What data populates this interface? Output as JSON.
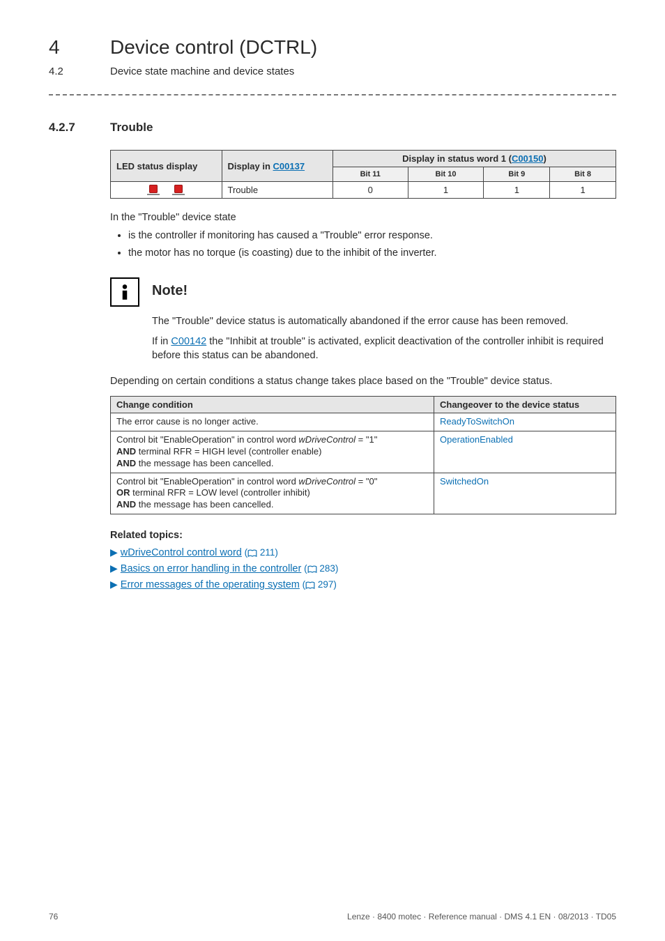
{
  "header": {
    "chapter_num": "4",
    "chapter_title": "Device control (DCTRL)",
    "sub_num": "4.2",
    "sub_title": "Device state machine and device states"
  },
  "section": {
    "num": "4.2.7",
    "title": "Trouble"
  },
  "table1": {
    "col_led": "LED status display",
    "col_display_in": "Display in ",
    "col_display_code": "C00137",
    "col_statusword": "Display in status word 1 (",
    "col_statusword_code": "C00150",
    "col_statusword_close": ")",
    "bit11": "Bit 11",
    "bit10": "Bit 10",
    "bit9": "Bit 9",
    "bit8": "Bit 8",
    "row_name": "Trouble",
    "v_b11": "0",
    "v_b10": "1",
    "v_b9": "1",
    "v_b8": "1"
  },
  "prose": {
    "intro": "In the \"Trouble\" device state",
    "li1": "is the controller if monitoring has caused a \"Trouble\" error response.",
    "li2": "the motor has no torque (is coasting) due to the inhibit of the inverter."
  },
  "note": {
    "title": "Note!",
    "p1": "The \"Trouble\" device status is automatically abandoned if the error cause has been removed.",
    "p2a": "If in ",
    "p2_code": "C00142",
    "p2b": " the \"Inhibit at trouble\" is activated, explicit deactivation of the controller inhibit is required before this status can be abandoned."
  },
  "between_para": "Depending on certain conditions a status change takes place based on the \"Trouble\" device status.",
  "table2": {
    "h1": "Change condition",
    "h2": "Changeover to the device status",
    "r1c1": "The error cause is no longer active.",
    "r1c2": "ReadyToSwitchOn",
    "r2c1_a": "Control bit \"EnableOperation\" in control word ",
    "r2c1_it": "wDriveControl",
    "r2c1_b": " = \"1\"",
    "r2c1_and1": "AND",
    "r2c1_line2": " terminal RFR = HIGH level (controller enable)",
    "r2c1_and2": "AND",
    "r2c1_line3": " the message has been cancelled.",
    "r2c2": "OperationEnabled",
    "r3c1_a": "Control bit \"EnableOperation\" in control word ",
    "r3c1_it": "wDriveControl",
    "r3c1_b": " = \"0\"",
    "r3c1_or": "OR",
    "r3c1_line2": " terminal RFR = LOW level (controller inhibit)",
    "r3c1_and": "AND",
    "r3c1_line3": " the message has been cancelled.",
    "r3c2": "SwitchedOn"
  },
  "related": {
    "title": "Related topics:",
    "items": [
      {
        "text": "wDriveControl control word",
        "page": "211"
      },
      {
        "text": "Basics on error handling in the controller",
        "page": "283"
      },
      {
        "text": "Error messages of the operating system",
        "page": "297"
      }
    ]
  },
  "footer": {
    "left": "76",
    "right": "Lenze · 8400 motec · Reference manual · DMS 4.1 EN · 08/2013 · TD05"
  }
}
